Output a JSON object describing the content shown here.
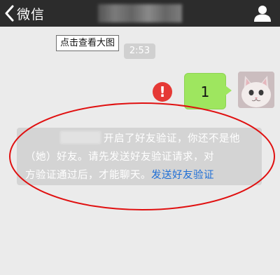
{
  "nav": {
    "back_label": "微信",
    "contact_name": "",
    "background_color": "#2c2c2c"
  },
  "tooltip": {
    "text": "点击查看大图"
  },
  "chat": {
    "timestamp": "2:53",
    "message": {
      "text": "1",
      "bubble_color": "#9ee65f",
      "status": "error-icon",
      "status_glyph": "!"
    },
    "system_notice": {
      "name": "",
      "line1": "开启了好友验证，你还不是他",
      "line2": "（她）好友。请先发送好友验证请求，对",
      "line3": "方验证通过后，才能聊天。",
      "link": "发送好友验证",
      "link_color": "#1f6fd6"
    }
  },
  "annotation": {
    "shape": "ellipse",
    "color": "#e01010"
  }
}
